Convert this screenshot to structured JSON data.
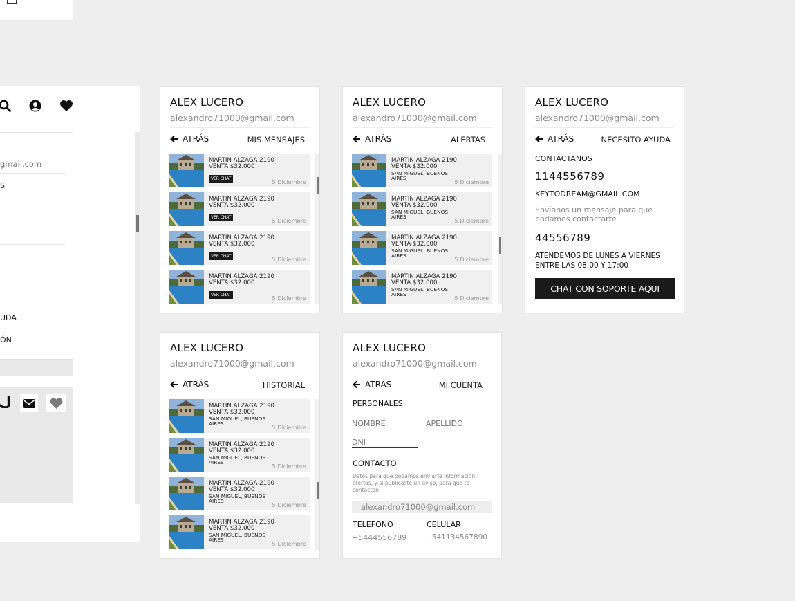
{
  "user": {
    "name": "ALEX LUCERO",
    "email": "alexandro71000@gmail.com"
  },
  "back_label": "ATRÁS",
  "listing": {
    "title": "MARTIN ALZAGA 2190",
    "price": "VENTA $32.000",
    "location": "SAN MIGUEL, BUENOS AIRES",
    "date": "5 Diciembre",
    "chat_label": "VER CHAT"
  },
  "left_panel": {
    "email_fragment": "gmail.com",
    "item_fragment_1": "S",
    "item_fragment_2": "UDA",
    "item_fragment_3": "ÓN"
  },
  "screens": {
    "mensajes": {
      "section": "MIS MENSAJES"
    },
    "alertas": {
      "section": "ALERTAS"
    },
    "ayuda": {
      "section": "NECESITO AYUDA",
      "contact_heading": "CONTACTANOS",
      "phone": "1144556789",
      "email_contact": "KEYTODREAM@GMAIL.COM",
      "message": "Envíanos un mensaje para que podamos contactarte",
      "phone2": "44556789",
      "hours": "ATENDEMOS DE LUNES A VIERNES ENTRE LAS 08:00 Y 17:00",
      "chat_button": "CHAT CON SOPORTE AQUI"
    },
    "historial": {
      "section": "HISTORIAL"
    },
    "cuenta": {
      "section": "MI CUENTA",
      "personal_heading": "PERSONALES",
      "first_name_placeholder": "NOMBRE",
      "last_name_placeholder": "APELLIDO",
      "dni_placeholder": "DNI",
      "contact_heading": "CONTACTO",
      "contact_note": "Datos para que podamos enviarte información, ofertas, y si publicaste un aviso, para que te contacten",
      "email_value": "alexandro71000@gmail.com",
      "phone_label": "TELEFONO",
      "phone_value": "+5444556789",
      "cell_label": "CELULAR",
      "cell_value": "+541134567890"
    }
  }
}
